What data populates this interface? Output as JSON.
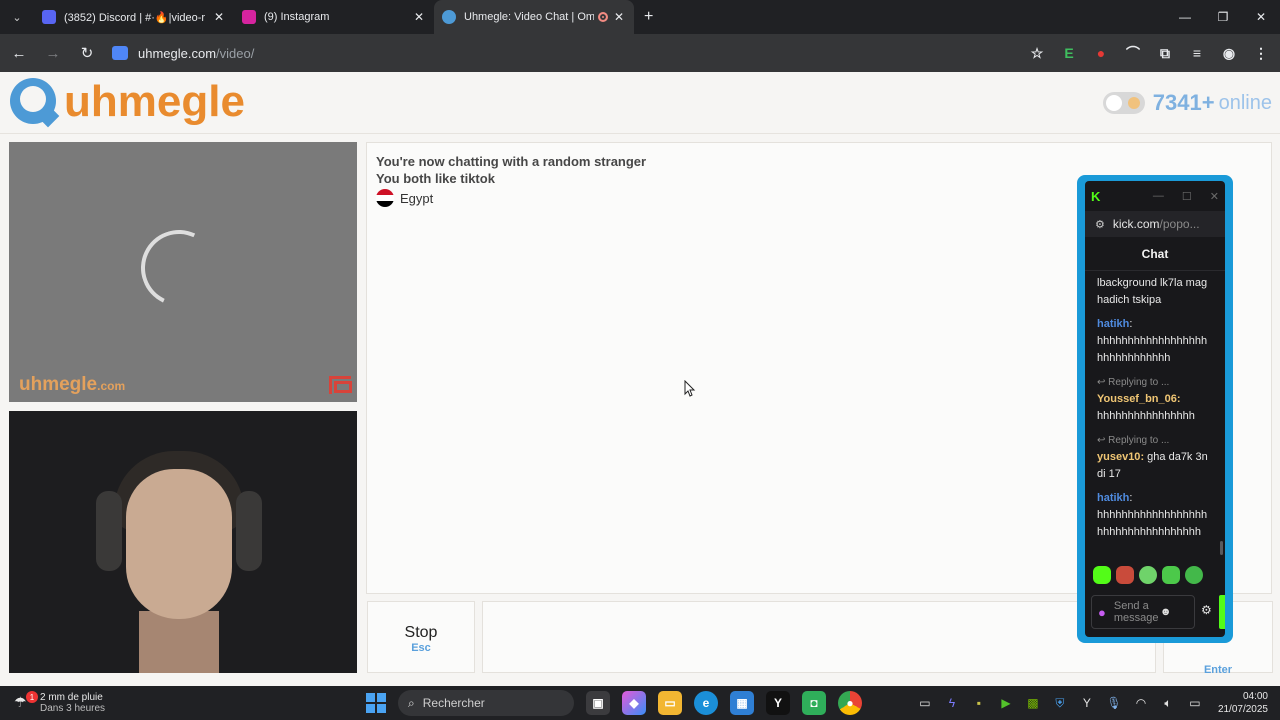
{
  "browser": {
    "tabs": [
      {
        "title": "(3852) Discord | #·🔥|video-r",
        "favicon_color": "#5865f2",
        "active": false
      },
      {
        "title": "(9) Instagram",
        "favicon_color": "#d6249f",
        "active": false
      },
      {
        "title": "Uhmegle: Video Chat | Ome",
        "favicon_color": "#4d9ad6",
        "active": true
      }
    ],
    "url_host": "uhmegle.com",
    "url_path": "/video/"
  },
  "site": {
    "logo_text": "uhmegle",
    "online_count": "7341",
    "online_plus": "+",
    "online_label": "online",
    "watermark": "uhmegle",
    "watermark_suffix": ".com"
  },
  "chat": {
    "status_line": "You're now chatting with a random stranger",
    "common_interest": "You both like tiktok",
    "country": "Egypt"
  },
  "controls": {
    "stop_label": "Stop",
    "stop_key": "Esc",
    "send_key": "Enter"
  },
  "kick": {
    "url_host": "kick.com",
    "url_path": "/popo...",
    "chat_title": "Chat",
    "messages": [
      {
        "user": "",
        "text": "lbackground lk7la maghadich tskipa",
        "reply": ""
      },
      {
        "user": "hatikh",
        "text": "hhhhhhhhhhhhhhhhhhhhhhhhhhhhhh",
        "reply": ""
      },
      {
        "user": "Youssef_bn_06",
        "text": "hhhhhhhhhhhhhhhh",
        "reply": "Replying to ..."
      },
      {
        "user": "yusev10",
        "text": "gha da7k 3ndi 17",
        "reply": "Replying to ..."
      },
      {
        "user": "hatikh",
        "text": "hhhhhhhhhhhhhhhhhhhhhhhhhhhhhhhhhhh",
        "reply": ""
      }
    ],
    "input_placeholder": "Send a message"
  },
  "taskbar": {
    "weather_title": "2 mm de pluie",
    "weather_sub": "Dans 3 heures",
    "weather_badge": "1",
    "search_placeholder": "Rechercher",
    "time": "04:00",
    "date": "21/07/2025"
  }
}
